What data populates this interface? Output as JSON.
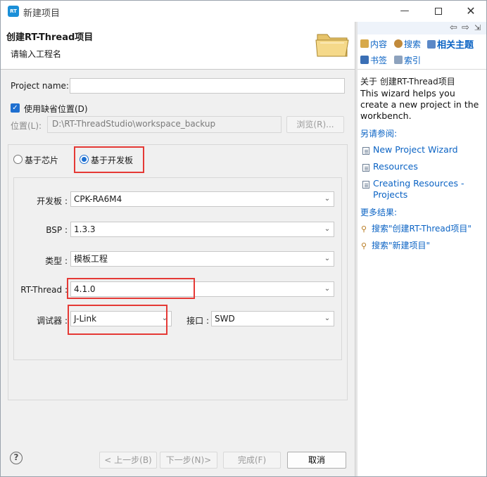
{
  "window": {
    "title": "新建项目",
    "app_icon_text": "RT"
  },
  "banner": {
    "title": "创建RT-Thread项目",
    "subtitle": "请输入工程名"
  },
  "form": {
    "project_name_label": "Project name:",
    "project_name_value": "",
    "use_default_location_label": "使用缺省位置(D)",
    "use_default_location_checked": true,
    "location_label": "位置(L):",
    "location_value": "D:\\RT-ThreadStudio\\workspace_backup",
    "browse_button": "浏览(R)...",
    "radio_chip_label": "基于芯片",
    "radio_board_label": "基于开发板",
    "selected_mode": "基于开发板",
    "board_label": "开发板 :",
    "board_value": "CPK-RA6M4",
    "bsp_label": "BSP :",
    "bsp_value": "1.3.3",
    "type_label": "类型 :",
    "type_value": "模板工程",
    "rtthread_label": "RT-Thread :",
    "rtthread_value": "4.1.0",
    "debugger_label": "调试器 :",
    "debugger_value": "J-Link",
    "interface_label": "接口 :",
    "interface_value": "SWD"
  },
  "buttons": {
    "back": "< 上一步(B)",
    "next": "下一步(N)>",
    "finish": "完成(F)",
    "cancel": "取消"
  },
  "help": {
    "tab_contents": "内容",
    "tab_search": "搜索",
    "tab_related": "相关主题",
    "tab_bookmarks": "书签",
    "tab_index": "索引",
    "about_heading": "关于 创建RT-Thread项目",
    "description": "This wizard helps you create a new project in the workbench.",
    "see_also_heading": "另请参阅:",
    "links": [
      "New Project Wizard",
      "Resources",
      "Creating Resources - Projects"
    ],
    "more_results_heading": "更多结果:",
    "search_results": [
      "搜索\"创建RT-Thread项目\"",
      "搜索\"新建项目\""
    ]
  },
  "colors": {
    "accent": "#1e6fd0",
    "link": "#0b63c4",
    "highlight_box": "#e53935"
  }
}
